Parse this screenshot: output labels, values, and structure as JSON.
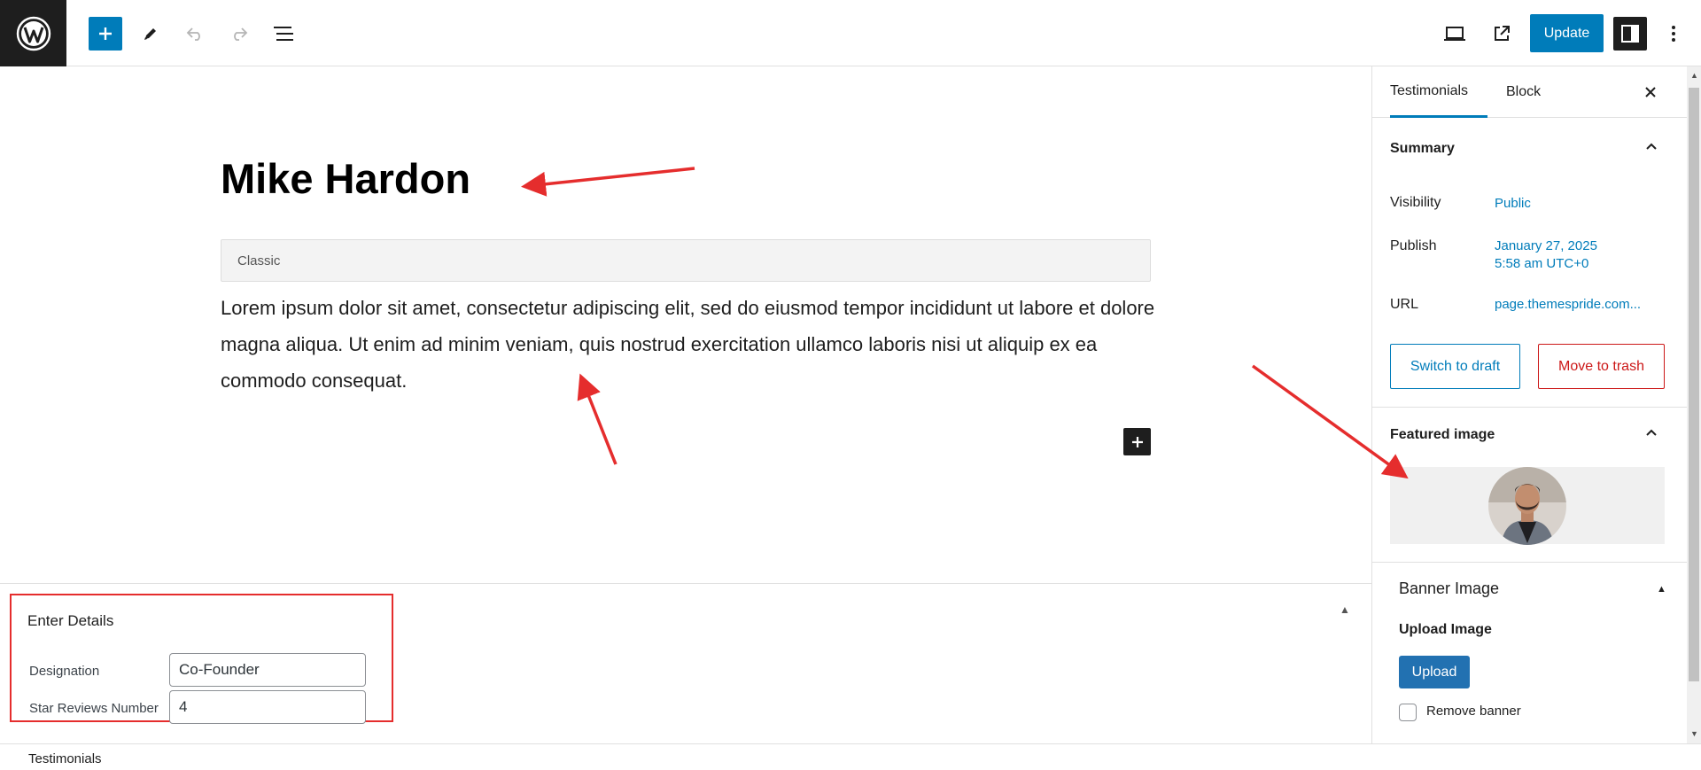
{
  "toolbar": {
    "logo_icon": "wordpress-logo",
    "add_icon": "plus-icon",
    "tools_icon": "pencil-icon",
    "undo_icon": "undo-icon",
    "redo_icon": "redo-icon",
    "list_view_icon": "list-view-icon",
    "preview_icon": "desktop-preview-icon",
    "view_post_icon": "external-link-icon",
    "update_label": "Update",
    "settings_icon": "sidebar-toggle-icon",
    "options_icon": "vertical-ellipsis-icon"
  },
  "editor": {
    "title": "Mike Hardon",
    "classic_label": "Classic",
    "body": "Lorem ipsum dolor sit amet, consectetur adipiscing elit, sed do eiusmod tempor incididunt ut labore et dolore magna aliqua. Ut enim ad minim veniam, quis nostrud exercitation ullamco laboris nisi ut aliquip ex ea commodo consequat."
  },
  "meta_box": {
    "title": "Enter Details",
    "fields": [
      {
        "label": "Designation",
        "value": "Co-Founder"
      },
      {
        "label": "Star Reviews Number",
        "value": "4"
      }
    ]
  },
  "footer": {
    "breadcrumb": "Testimonials"
  },
  "sidebar": {
    "tabs": [
      "Testimonials",
      "Block"
    ],
    "summary": {
      "title": "Summary",
      "visibility_label": "Visibility",
      "visibility_value": "Public",
      "publish_label": "Publish",
      "publish_date": "January 27, 2025",
      "publish_time": "5:58 am UTC+0",
      "url_label": "URL",
      "url_value": "page.themespride.com...",
      "switch_to_draft": "Switch to draft",
      "move_to_trash": "Move to trash"
    },
    "featured_image": {
      "title": "Featured image"
    },
    "banner": {
      "title": "Banner Image",
      "upload_label": "Upload Image",
      "upload_button": "Upload",
      "remove_label": "Remove banner"
    }
  },
  "colors": {
    "accent": "#007cba",
    "annotation_red": "#e52d2d",
    "trash_red": "#cc1818",
    "dark": "#1e1e1e"
  }
}
